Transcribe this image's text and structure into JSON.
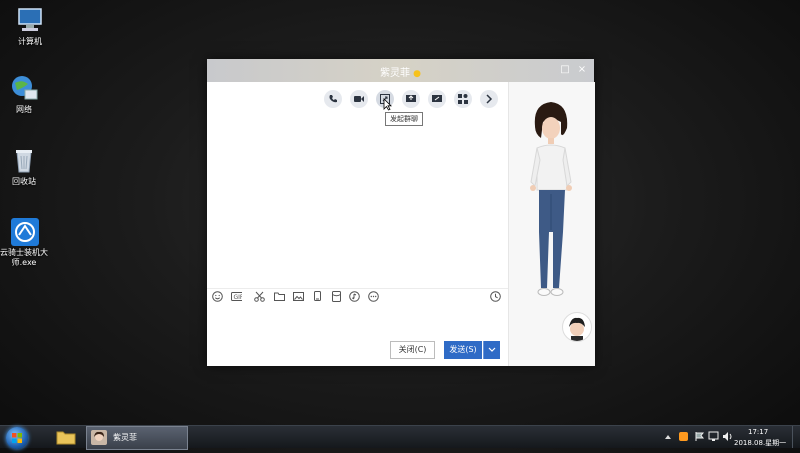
{
  "desktop": {
    "icons": [
      {
        "label": "计算机"
      },
      {
        "label": "网络"
      },
      {
        "label": "回收站"
      },
      {
        "label": "云骑士装机大师.exe"
      }
    ]
  },
  "window": {
    "title": "紫灵菲",
    "tooltip": "发起群聊",
    "close_label": "关闭(C)",
    "send_label": "发送(S)",
    "header_icons": [
      "phone-icon",
      "video-icon",
      "group-chat-icon",
      "share-screen-icon",
      "remote-assist-icon",
      "apps-icon",
      "more-arrow-icon"
    ],
    "toolbar_icons": [
      "emoji-icon",
      "gif-icon",
      "screenshot-icon",
      "folder-icon",
      "image-icon",
      "voice-icon",
      "red-packet-icon",
      "music-icon",
      "more-icon"
    ],
    "history_icon": "clock-icon"
  },
  "taskbar": {
    "active_task": "紫灵菲",
    "time": "17:17",
    "date": "2018.08.星期一"
  },
  "colors": {
    "accent": "#2f6bc6",
    "titlebar": "#d3d0c8"
  }
}
